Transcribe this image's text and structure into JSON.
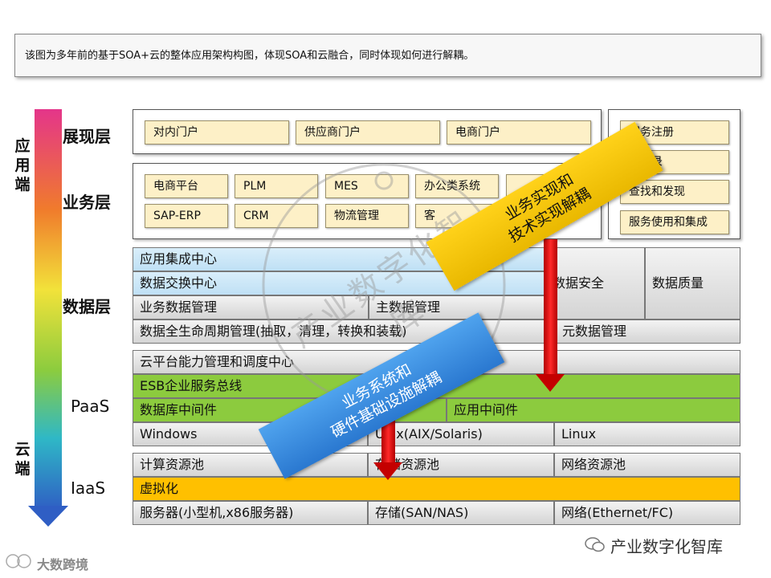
{
  "note": "该图为多年前的基于SOA+云的整体应用架构构图，体现SOA和云融合，同时体现如何进行解耦。",
  "side": {
    "top": "应用端",
    "bottom": "云端"
  },
  "layers": {
    "presentation": "展现层",
    "business": "业务层",
    "data": "数据层",
    "paas": "PaaS",
    "iaas": "IaaS"
  },
  "presentation_tiles": [
    "对内门户",
    "供应商门户",
    "电商门户"
  ],
  "business_tiles": [
    "电商平台",
    "PLM",
    "MES",
    "办公类系统",
    "SAP-ERP",
    "CRM",
    "物流管理",
    "客"
  ],
  "service_tiles": [
    "服务注册",
    "务目录",
    "查找和发现",
    "服务使用和集成"
  ],
  "data_rows": {
    "app_integration": "应用集成中心",
    "data_exchange": "数据交换中心",
    "biz_data": "业务数据管理",
    "master_data": "主数据管理",
    "lifecycle": "数据全生命周期管理(抽取，清理，转换和装载)",
    "meta_data": "元数据管理",
    "security": "数据安全",
    "quality": "数据质量"
  },
  "paas_rows": {
    "cloud_mgmt": "云平台能力管理和调度中心",
    "esb": "ESB企业服务总线",
    "db_middleware": "数据库中间件",
    "app_middleware": "应用中间件",
    "windows": "Windows",
    "unix": "Unix(AIX/Solaris)",
    "linux": "Linux"
  },
  "iaas_rows": {
    "compute": "计算资源池",
    "storage_pool": "存储资源池",
    "network_pool": "网络资源池",
    "virtualization": "虚拟化",
    "servers": "服务器(小型机,x86服务器)",
    "storage": "存储(SAN/NAS)",
    "network": "网络(Ethernet/FC)"
  },
  "banners": {
    "yellow": [
      "业务实现和",
      "技术实现解耦"
    ],
    "blue": [
      "业务系统和",
      "硬件基础设施解耦"
    ]
  },
  "watermarks": {
    "center": "产业数字化智库",
    "bottom_right": "产业数字化智库",
    "bottom_left": "大数跨境"
  },
  "colors": {
    "tile": "#fdf0c7",
    "blue_row": "#cfe8f7",
    "green_row": "#8ccb3e",
    "orange_row": "#ffc000",
    "yellow_banner": "#f2c200",
    "blue_banner": "#3a8ee0",
    "red_arrow": "#d10000"
  }
}
